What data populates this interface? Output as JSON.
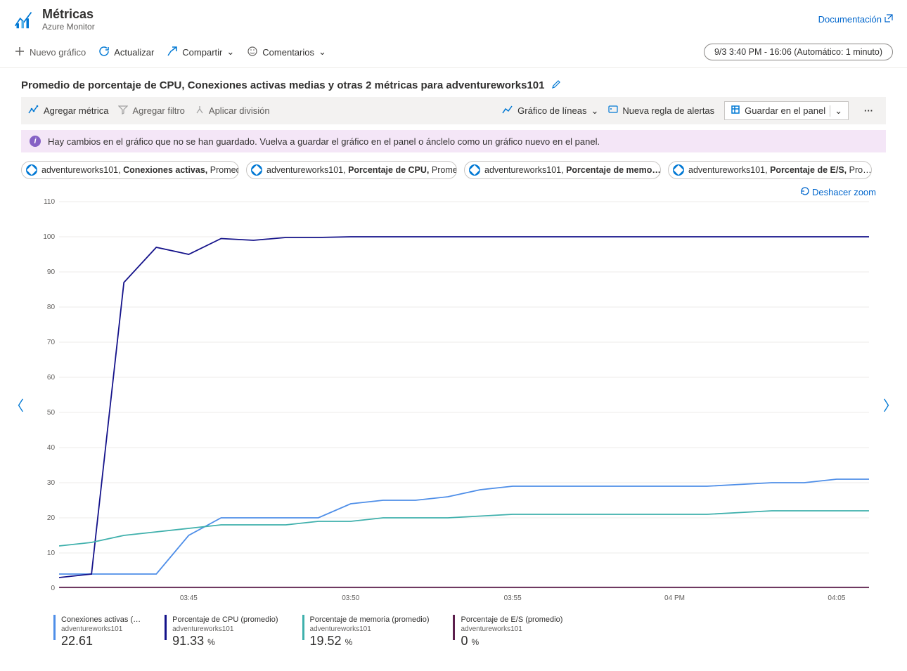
{
  "header": {
    "title": "Métricas",
    "subtitle": "Azure Monitor",
    "documentation": "Documentación"
  },
  "toolbar": {
    "new_chart": "Nuevo gráfico",
    "refresh": "Actualizar",
    "share": "Compartir",
    "feedback": "Comentarios",
    "time_range": "9/3 3:40 PM - 16:06 (Automático: 1 minuto)"
  },
  "chart": {
    "title": "Promedio de porcentaje de CPU, Conexiones activas medias y otras 2 métricas para adventureworks101"
  },
  "configbar": {
    "add_metric": "Agregar métrica",
    "add_filter": "Agregar filtro",
    "apply_splitting": "Aplicar división",
    "chart_type": "Gráfico de líneas",
    "new_alert": "Nueva regla de alertas",
    "save": "Guardar en el panel"
  },
  "alert": {
    "text": "Hay cambios en el gráfico que no se han guardado. Vuelva a guardar el gráfico en el panel o ánclelo como un gráfico nuevo en el panel."
  },
  "pills": [
    {
      "resource": "adventureworks101,",
      "metric": "Conexiones activas,",
      "agg": "Promedio"
    },
    {
      "resource": "adventureworks101,",
      "metric": "Porcentaje de CPU,",
      "agg": "Promedio"
    },
    {
      "resource": "adventureworks101,",
      "metric": "Porcentaje de memo…,",
      "agg": ""
    },
    {
      "resource": "adventureworks101,",
      "metric": "Porcentaje de E/S,",
      "agg": "Pro…"
    }
  ],
  "undo_zoom": "Deshacer zoom",
  "chart_data": {
    "type": "line",
    "x": [
      "03:41",
      "03:42",
      "03:43",
      "03:44",
      "03:45",
      "03:46",
      "03:47",
      "03:48",
      "03:49",
      "03:50",
      "03:51",
      "03:52",
      "03:53",
      "03:54",
      "03:55",
      "03:56",
      "03:57",
      "03:58",
      "03:59",
      "04:00",
      "04:01",
      "04:02",
      "04:03",
      "04:04",
      "04:05",
      "04:06"
    ],
    "x_ticks": [
      "03:45",
      "03:50",
      "03:55",
      "04 PM",
      "04:05"
    ],
    "y_ticks": [
      0,
      10,
      20,
      30,
      40,
      50,
      60,
      70,
      80,
      90,
      100,
      110
    ],
    "ylim": [
      0,
      110
    ],
    "series": [
      {
        "name": "Conexiones activas (promedio)",
        "resource": "adventureworks101",
        "color": "#4e8ee8",
        "values": [
          4,
          4,
          4,
          4,
          15,
          20,
          20,
          20,
          20,
          24,
          25,
          25,
          26,
          28,
          29,
          29,
          29,
          29,
          29,
          29,
          29,
          29.5,
          30,
          30,
          31,
          31
        ],
        "legend_value": "22.61",
        "unit": ""
      },
      {
        "name": "Porcentaje de CPU (promedio)",
        "resource": "adventureworks101",
        "color": "#14128a",
        "values": [
          3,
          4,
          87,
          97,
          95,
          99.5,
          99,
          99.8,
          99.8,
          100,
          100,
          100,
          100,
          100,
          100,
          100,
          100,
          100,
          100,
          100,
          100,
          100,
          100,
          100,
          100,
          100
        ],
        "legend_value": "91.33",
        "unit": "%"
      },
      {
        "name": "Porcentaje de memoria (promedio)",
        "resource": "adventureworks101",
        "color": "#3fb0ac",
        "values": [
          12,
          13,
          15,
          16,
          17,
          18,
          18,
          18,
          19,
          19,
          20,
          20,
          20,
          20.5,
          21,
          21,
          21,
          21,
          21,
          21,
          21,
          21.5,
          22,
          22,
          22,
          22
        ],
        "legend_value": "19.52",
        "unit": "%"
      },
      {
        "name": "Porcentaje de E/S (promedio)",
        "resource": "adventureworks101",
        "color": "#5c1f4d",
        "values": [
          0.2,
          0.2,
          0.2,
          0.2,
          0.2,
          0.2,
          0.2,
          0.2,
          0.2,
          0.2,
          0.2,
          0.2,
          0.2,
          0.2,
          0.2,
          0.2,
          0.2,
          0.2,
          0.2,
          0.2,
          0.2,
          0.2,
          0.2,
          0.2,
          0.2,
          0.2
        ],
        "legend_value": "0",
        "unit": "%"
      }
    ]
  },
  "legend_labels": {
    "s0_title": "Conexiones activas (…",
    "s1_title": "Porcentaje de CPU (promedio)",
    "s2_title": "Porcentaje de memoria (promedio)",
    "s3_title": "Porcentaje de E/S (promedio)"
  }
}
